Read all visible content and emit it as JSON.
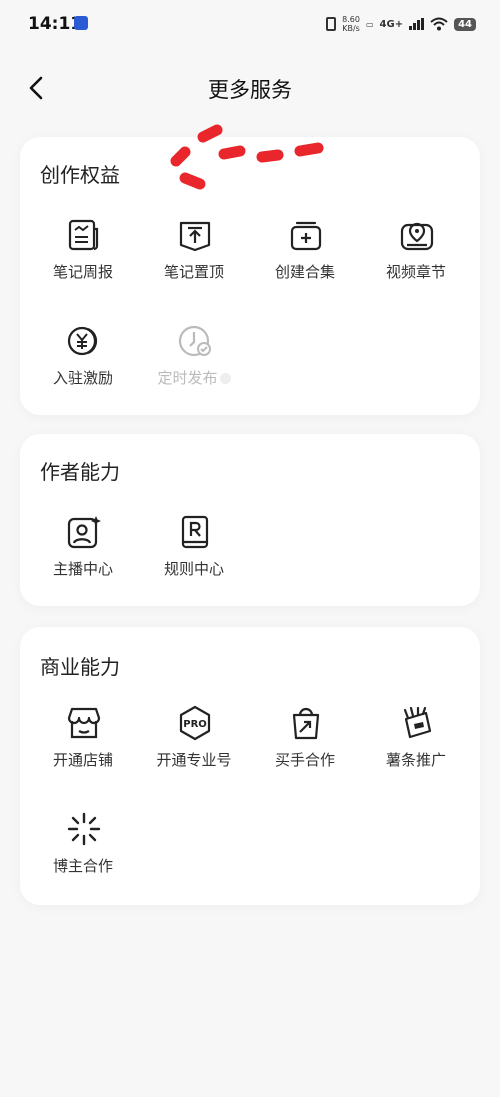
{
  "status": {
    "time": "14:11",
    "speed_value": "8.60",
    "speed_unit": "KB/s",
    "network": "4G+",
    "battery": "44"
  },
  "nav": {
    "title": "更多服务"
  },
  "sections": [
    {
      "title": "创作权益",
      "items": [
        {
          "label": "笔记周报",
          "icon": "report-icon"
        },
        {
          "label": "笔记置顶",
          "icon": "pin-top-icon"
        },
        {
          "label": "创建合集",
          "icon": "collection-add-icon"
        },
        {
          "label": "视频章节",
          "icon": "video-chapter-icon"
        },
        {
          "label": "入驻激励",
          "icon": "yuan-coin-icon"
        },
        {
          "label": "定时发布",
          "icon": "clock-check-icon"
        }
      ]
    },
    {
      "title": "作者能力",
      "items": [
        {
          "label": "主播中心",
          "icon": "anchor-profile-icon"
        },
        {
          "label": "规则中心",
          "icon": "rules-book-icon"
        }
      ]
    },
    {
      "title": "商业能力",
      "items": [
        {
          "label": "开通店铺",
          "icon": "shop-icon"
        },
        {
          "label": "开通专业号",
          "icon": "pro-badge-icon"
        },
        {
          "label": "买手合作",
          "icon": "shopping-bag-icon"
        },
        {
          "label": "薯条推广",
          "icon": "fries-promo-icon"
        },
        {
          "label": "博主合作",
          "icon": "sparkle-icon"
        }
      ]
    }
  ],
  "colors": {
    "annotation": "#e8262c",
    "icon_stroke": "#222222",
    "disabled": "#bbbbbb"
  }
}
